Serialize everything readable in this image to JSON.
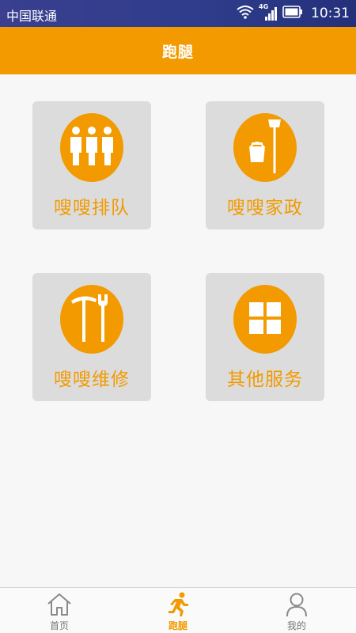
{
  "status_bar": {
    "carrier": "中国联通",
    "network": "4G",
    "time": "10:31",
    "icons": [
      "wifi-icon",
      "signal-icon",
      "battery-icon"
    ]
  },
  "header": {
    "title": "跑腿"
  },
  "services": [
    {
      "label": "嗖嗖排队",
      "icon": "people-queue-icon"
    },
    {
      "label": "嗖嗖家政",
      "icon": "broom-bucket-icon"
    },
    {
      "label": "嗖嗖维修",
      "icon": "pickaxe-wrench-icon"
    },
    {
      "label": "其他服务",
      "icon": "grid-icon"
    }
  ],
  "tabbar": {
    "items": [
      {
        "label": "首页",
        "icon": "home-icon"
      },
      {
        "label": "跑腿",
        "icon": "running-icon",
        "active": true
      },
      {
        "label": "我的",
        "icon": "user-icon"
      }
    ]
  },
  "colors": {
    "accent": "#f29a00",
    "tile_background": "#dcdcdc",
    "status_bar": "#2f3d8c"
  }
}
